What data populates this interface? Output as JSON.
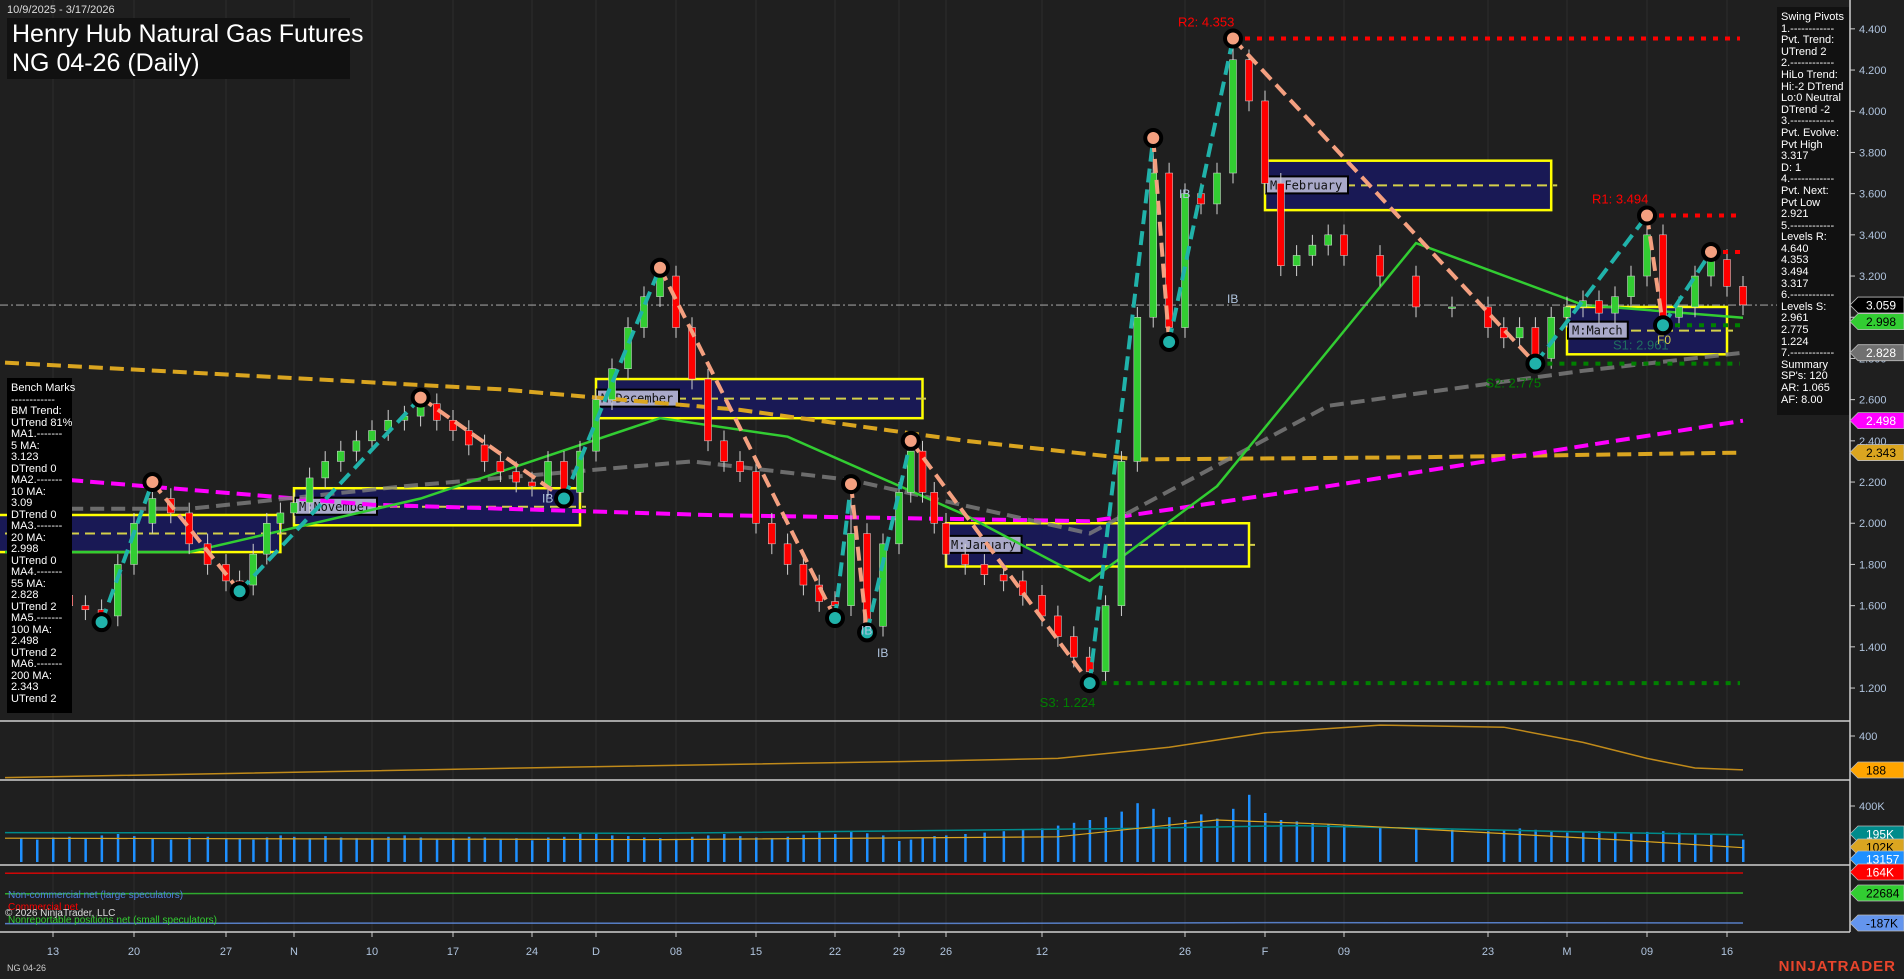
{
  "header": {
    "date_range": "10/9/2025 - 3/17/2026",
    "title": "Henry Hub Natural Gas Futures",
    "subtitle": "NG 04-26 (Daily)"
  },
  "bench_marks": [
    "Bench Marks",
    "------------",
    "BM Trend:",
    "UTrend 81%",
    "MA1.-------",
    "5 MA:",
    "3.123",
    "DTrend 0",
    "MA2.-------",
    "10 MA:",
    "3.09",
    "DTrend 0",
    "MA3.-------",
    "20 MA:",
    "2.998",
    "UTrend 0",
    "MA4.-------",
    "55 MA:",
    "2.828",
    "UTrend 2",
    "MA5.-------",
    "100 MA:",
    "2.498",
    "UTrend 2",
    "MA6.-------",
    "200 MA:",
    "2.343",
    "UTrend 2"
  ],
  "swing_pivots": [
    "Swing Pivots",
    "1.------------",
    "Pvt. Trend:",
    "UTrend 2",
    "2.------------",
    "HiLo Trend:",
    "Hi:-2 DTrend",
    "Lo:0 Neutral",
    "DTrend -2",
    "3.------------",
    "Pvt. Evolve:",
    "Pvt High",
    "3.317",
    "D: 1",
    "4.------------",
    "Pvt. Next:",
    "Pvt Low",
    "2.921",
    "5.------------",
    "Levels R:",
    "4.640",
    "4.353",
    "3.494",
    "3.317",
    "6.------------",
    "Levels S:",
    "2.961",
    "2.775",
    "1.224",
    "7.------------",
    "Summary",
    "SP's: 120",
    "AR: 1.065",
    "AF: 8.00"
  ],
  "footer": {
    "instrument": "NG 04-26",
    "brand": "NINJATRADER",
    "copyright": "© 2026 NinjaTrader, LLC"
  },
  "legends": {
    "noncommercial": "Non-commercial net (large speculators)",
    "commercial": "Commercial net",
    "nonreportable": "Nonreportable positions net (small speculators)"
  },
  "chart_data": {
    "type": "candlestick",
    "ylim": [
      1.04,
      4.54
    ],
    "y_ticks": [
      "1.200",
      "1.400",
      "1.600",
      "1.800",
      "2.000",
      "2.200",
      "2.400",
      "2.600",
      "2.800",
      "3.000",
      "3.200",
      "3.400",
      "3.600",
      "3.800",
      "4.000",
      "4.200",
      "4.400"
    ],
    "x_ticks": [
      {
        "label": "13",
        "i": 2
      },
      {
        "label": "20",
        "i": 7
      },
      {
        "label": "27",
        "i": 12
      },
      {
        "label": "N",
        "i": 17
      },
      {
        "label": "10",
        "i": 22
      },
      {
        "label": "17",
        "i": 27
      },
      {
        "label": "24",
        "i": 32
      },
      {
        "label": "D",
        "i": 36
      },
      {
        "label": "08",
        "i": 41
      },
      {
        "label": "15",
        "i": 46
      },
      {
        "label": "22",
        "i": 51
      },
      {
        "label": "29",
        "i": 55
      },
      {
        "label": "26",
        "i": 59
      },
      {
        "label": "12",
        "i": 64
      },
      {
        "label": "26",
        "i": 73
      },
      {
        "label": "F",
        "i": 78
      },
      {
        "label": "09",
        "i": 83
      },
      {
        "label": "23",
        "i": 87
      },
      {
        "label": "M",
        "i": 92
      },
      {
        "label": "09",
        "i": 97
      },
      {
        "label": "16",
        "i": 102
      }
    ],
    "closes": [
      1.8,
      1.72,
      1.65,
      1.6,
      1.58,
      1.55,
      1.8,
      2.0,
      2.12,
      2.05,
      1.9,
      1.8,
      1.72,
      1.7,
      1.85,
      2.0,
      2.05,
      2.1,
      2.22,
      2.3,
      2.35,
      2.4,
      2.45,
      2.5,
      2.52,
      2.58,
      2.5,
      2.45,
      2.38,
      2.3,
      2.25,
      2.2,
      2.18,
      2.3,
      2.15,
      2.35,
      2.6,
      2.75,
      2.95,
      3.1,
      3.2,
      2.95,
      2.7,
      2.4,
      2.3,
      2.25,
      2.0,
      1.9,
      1.8,
      1.7,
      1.62,
      1.6,
      1.95,
      1.5,
      1.9,
      2.15,
      2.35,
      2.15,
      2.0,
      1.85,
      1.8,
      1.75,
      1.72,
      1.65,
      1.55,
      1.45,
      1.35,
      1.28,
      1.6,
      2.3,
      3.0,
      3.7,
      2.95,
      3.6,
      3.55,
      3.7,
      4.25,
      4.05,
      3.65,
      3.25,
      3.3,
      3.35,
      3.4,
      3.3,
      3.2,
      3.05,
      3.05,
      2.95,
      2.9,
      2.95,
      2.8,
      3.0,
      3.05,
      3.08,
      3.02,
      3.1,
      3.2,
      3.4,
      3.0,
      3.05,
      3.2,
      3.28,
      3.15,
      3.06
    ],
    "pivots": [
      {
        "i": 5,
        "price": 1.52,
        "type": "low"
      },
      {
        "i": 8,
        "price": 2.2,
        "type": "high"
      },
      {
        "i": 13,
        "price": 1.67,
        "type": "low"
      },
      {
        "i": 25,
        "price": 2.61,
        "type": "high"
      },
      {
        "i": 34,
        "price": 2.12,
        "type": "low"
      },
      {
        "i": 40,
        "price": 3.24,
        "type": "high"
      },
      {
        "i": 51,
        "price": 1.54,
        "type": "low"
      },
      {
        "i": 52,
        "price": 2.19,
        "type": "high"
      },
      {
        "i": 53,
        "price": 1.47,
        "type": "low"
      },
      {
        "i": 56,
        "price": 2.4,
        "type": "high"
      },
      {
        "i": 67,
        "price": 1.224,
        "type": "low"
      },
      {
        "i": 71,
        "price": 3.87,
        "type": "high"
      },
      {
        "i": 72,
        "price": 2.88,
        "type": "low"
      },
      {
        "i": 76,
        "price": 4.353,
        "type": "high"
      },
      {
        "i": 90,
        "price": 2.775,
        "type": "low"
      },
      {
        "i": 97,
        "price": 3.494,
        "type": "high"
      },
      {
        "i": 98,
        "price": 2.961,
        "type": "low"
      },
      {
        "i": 101,
        "price": 3.317,
        "type": "high"
      }
    ],
    "levels": [
      {
        "label": "R2: 4.353",
        "price": 4.353,
        "from": 76,
        "kind": "resistance"
      },
      {
        "label": "R1: 3.494",
        "price": 3.494,
        "from": 97,
        "kind": "resistance"
      },
      {
        "label": "",
        "price": 3.317,
        "from": 101,
        "kind": "resistance"
      },
      {
        "label": "S1: 2.961",
        "price": 2.961,
        "from": 98,
        "kind": "support"
      },
      {
        "label": "S2: 2.775",
        "price": 2.775,
        "from": 90,
        "kind": "support"
      },
      {
        "label": "S3: 1.224",
        "price": 1.224,
        "from": 67,
        "kind": "support"
      }
    ],
    "last_price": {
      "label": "3.059",
      "value": 3.059
    },
    "moving_averages": [
      {
        "name": "200 MA",
        "label": "2.343",
        "color": "#daa520",
        "dash": true,
        "points": [
          [
            -1,
            2.78
          ],
          [
            30,
            2.65
          ],
          [
            45,
            2.55
          ],
          [
            60,
            2.4
          ],
          [
            70,
            2.31
          ],
          [
            85,
            2.32
          ],
          [
            103,
            2.343
          ]
        ]
      },
      {
        "name": "100 MA",
        "label": "2.498",
        "color": "#ff00ff",
        "dash": true,
        "points": [
          [
            3,
            2.21
          ],
          [
            22,
            2.09
          ],
          [
            43,
            2.04
          ],
          [
            67,
            2.01
          ],
          [
            82,
            2.18
          ],
          [
            103,
            2.498
          ]
        ]
      },
      {
        "name": "55 MA",
        "label": "2.828",
        "color": "#808080",
        "dash": true,
        "points": [
          [
            3,
            2.07
          ],
          [
            10,
            2.07
          ],
          [
            24,
            2.18
          ],
          [
            42,
            2.3
          ],
          [
            52,
            2.21
          ],
          [
            67,
            1.95
          ],
          [
            82,
            2.57
          ],
          [
            93,
            2.74
          ],
          [
            103,
            2.828
          ]
        ]
      },
      {
        "name": "20 MA",
        "label": "2.998",
        "color": "#32cd32",
        "dash": false,
        "points": [
          [
            -1,
            1.86
          ],
          [
            10,
            1.86
          ],
          [
            25,
            2.12
          ],
          [
            40,
            2.51
          ],
          [
            48,
            2.42
          ],
          [
            60,
            2.04
          ],
          [
            67,
            1.72
          ],
          [
            75,
            2.18
          ],
          [
            85,
            3.36
          ],
          [
            93,
            3.06
          ],
          [
            103,
            2.998
          ]
        ]
      }
    ],
    "zones": [
      {
        "label": "",
        "i0": -2,
        "i1": 16,
        "hi": 2.04,
        "lo": 1.86
      },
      {
        "label": "M:November",
        "i0": 17,
        "i1": 35,
        "hi": 2.17,
        "lo": 1.99
      },
      {
        "label": "M:December",
        "i0": 36,
        "i1": 57,
        "hi": 2.7,
        "lo": 2.51
      },
      {
        "label": "M:January",
        "i0": 59,
        "i1": 77,
        "hi": 2.0,
        "lo": 1.79
      },
      {
        "label": "M:February",
        "i0": 78,
        "i1": 91,
        "hi": 3.76,
        "lo": 3.52
      },
      {
        "label": "M:March",
        "i0": 92,
        "i1": 102,
        "hi": 3.05,
        "lo": 2.82
      }
    ],
    "annotations": [
      {
        "text": "IB",
        "i": 54,
        "price": 1.35
      },
      {
        "text": "IB",
        "i": 53,
        "price": 1.46
      },
      {
        "text": "IB",
        "i": 33,
        "price": 2.1
      },
      {
        "text": "IB",
        "i": 73,
        "price": 3.58
      },
      {
        "text": "IB",
        "i": 76,
        "price": 3.07
      },
      {
        "text": "F0",
        "i": 98,
        "price": 2.87
      }
    ],
    "oscillator": {
      "tick": "400",
      "value_label": "188",
      "points": [
        [
          -1,
          140
        ],
        [
          34,
          205
        ],
        [
          55,
          240
        ],
        [
          65,
          260
        ],
        [
          72,
          330
        ],
        [
          78,
          420
        ],
        [
          84,
          468
        ],
        [
          88,
          455
        ],
        [
          93,
          360
        ],
        [
          97,
          260
        ],
        [
          100,
          200
        ],
        [
          103,
          188
        ]
      ]
    },
    "volume": {
      "tick": "400K",
      "labels": [
        {
          "text": "195K",
          "color": "#008b8b"
        },
        {
          "text": "102K",
          "color": "#daa520"
        },
        {
          "text": "13157",
          "color": "#1e90ff"
        }
      ],
      "values_k": [
        170,
        160,
        175,
        180,
        165,
        190,
        200,
        185,
        170,
        160,
        175,
        180,
        170,
        165,
        160,
        175,
        190,
        180,
        170,
        185,
        175,
        170,
        165,
        180,
        190,
        175,
        160,
        170,
        180,
        175,
        165,
        170,
        155,
        175,
        180,
        200,
        210,
        190,
        185,
        175,
        170,
        165,
        180,
        190,
        200,
        185,
        175,
        170,
        180,
        195,
        210,
        200,
        220,
        205,
        190,
        150,
        160,
        175,
        185,
        190,
        200,
        210,
        220,
        230,
        240,
        260,
        280,
        300,
        320,
        360,
        420,
        380,
        320,
        300,
        340,
        310,
        380,
        480,
        350,
        300,
        290,
        280,
        270,
        260,
        250,
        240,
        230,
        220,
        230,
        240,
        230,
        220,
        210,
        215,
        220,
        210,
        205,
        215,
        220,
        210,
        200,
        195,
        190,
        160
      ],
      "line_195k": [
        [
          -1,
          210
        ],
        [
          40,
          205
        ],
        [
          70,
          240
        ],
        [
          80,
          260
        ],
        [
          95,
          210
        ],
        [
          103,
          195
        ]
      ],
      "line_102k": [
        [
          -1,
          170
        ],
        [
          40,
          160
        ],
        [
          65,
          180
        ],
        [
          75,
          300
        ],
        [
          82,
          270
        ],
        [
          95,
          160
        ],
        [
          103,
          102
        ]
      ]
    },
    "cot": [
      {
        "name": "Commercial net",
        "label": "164K",
        "color": "#ff0000",
        "points": [
          [
            -1,
            160
          ],
          [
            20,
            168
          ],
          [
            40,
            150
          ],
          [
            70,
            140
          ],
          [
            103,
            164
          ]
        ]
      },
      {
        "name": "Nonreportable positions net",
        "label": "22684",
        "color": "#32cd32",
        "points": [
          [
            -1,
            20
          ],
          [
            30,
            22
          ],
          [
            70,
            21
          ],
          [
            103,
            22.7
          ]
        ]
      },
      {
        "name": "Non-commercial net",
        "label": "-187K",
        "color": "#6495ed",
        "points": [
          [
            -1,
            -200
          ],
          [
            20,
            -190
          ],
          [
            60,
            -195
          ],
          [
            80,
            -180
          ],
          [
            103,
            -187
          ]
        ]
      }
    ]
  }
}
